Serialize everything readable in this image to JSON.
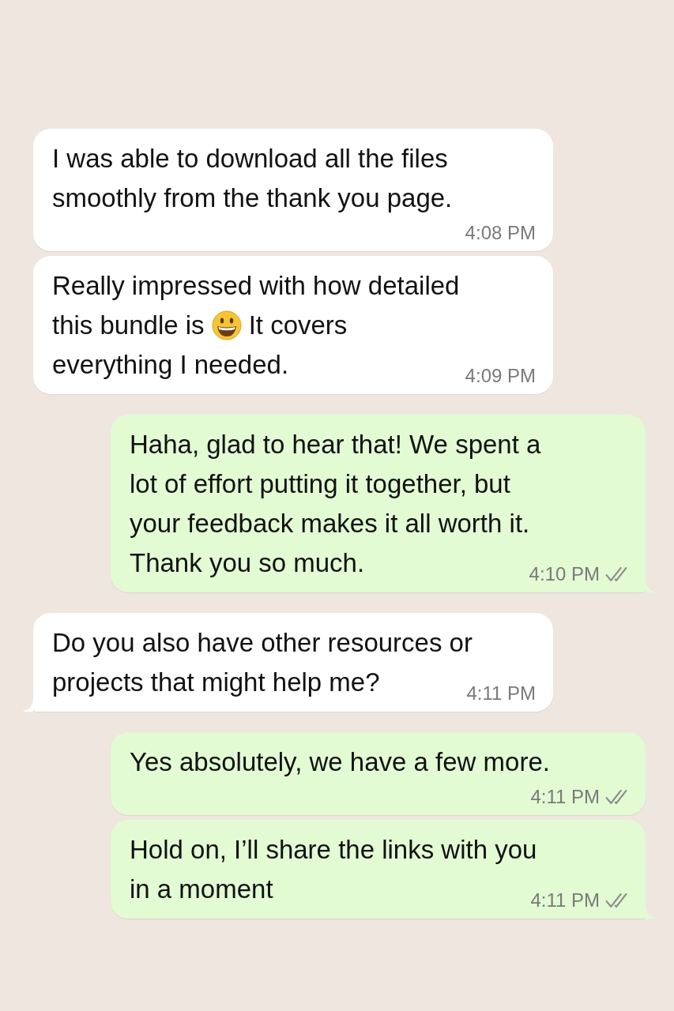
{
  "messages": [
    {
      "outgoing": false,
      "tail": false,
      "lines": [
        [
          {
            "kind": "text",
            "text": "I was able to download all the files"
          }
        ],
        [
          {
            "kind": "text",
            "text": "smoothly from the thank you page."
          }
        ]
      ],
      "time": "4:08 PM"
    },
    {
      "outgoing": false,
      "tail": false,
      "lines": [
        [
          {
            "kind": "text",
            "text": "Really impressed with how detailed"
          }
        ],
        [
          {
            "kind": "text",
            "text": "this bundle is"
          },
          {
            "kind": "emoji"
          },
          {
            "kind": "text",
            "text": "It covers"
          }
        ],
        [
          {
            "kind": "text",
            "text": "everything I needed."
          }
        ]
      ],
      "time": "4:09 PM"
    },
    {
      "outgoing": true,
      "tail": true,
      "read": false,
      "lines": [
        [
          {
            "kind": "text",
            "text": "Haha, glad to hear that! We spent a"
          }
        ],
        [
          {
            "kind": "text",
            "text": "lot of effort putting it together, but"
          }
        ],
        [
          {
            "kind": "text",
            "text": "your feedback makes it all worth it."
          }
        ],
        [
          {
            "kind": "text",
            "text": "Thank you so much."
          }
        ]
      ],
      "time": "4:10 PM"
    },
    {
      "outgoing": false,
      "tail": true,
      "lines": [
        [
          {
            "kind": "text",
            "text": "Do you also have other resources or"
          }
        ],
        [
          {
            "kind": "text",
            "text": "projects that might help me?"
          }
        ]
      ],
      "time": "4:11 PM"
    },
    {
      "outgoing": true,
      "tail": false,
      "read": false,
      "lines": [
        [
          {
            "kind": "text",
            "text": "Yes absolutely, we have a few more."
          }
        ]
      ],
      "time": "4:11 PM"
    },
    {
      "outgoing": true,
      "tail": true,
      "read": false,
      "lines": [
        [
          {
            "kind": "text",
            "text": "Hold on, I’ll share the links with you"
          }
        ],
        [
          {
            "kind": "text",
            "text": "in a moment"
          }
        ]
      ],
      "time": "4:11 PM"
    }
  ]
}
